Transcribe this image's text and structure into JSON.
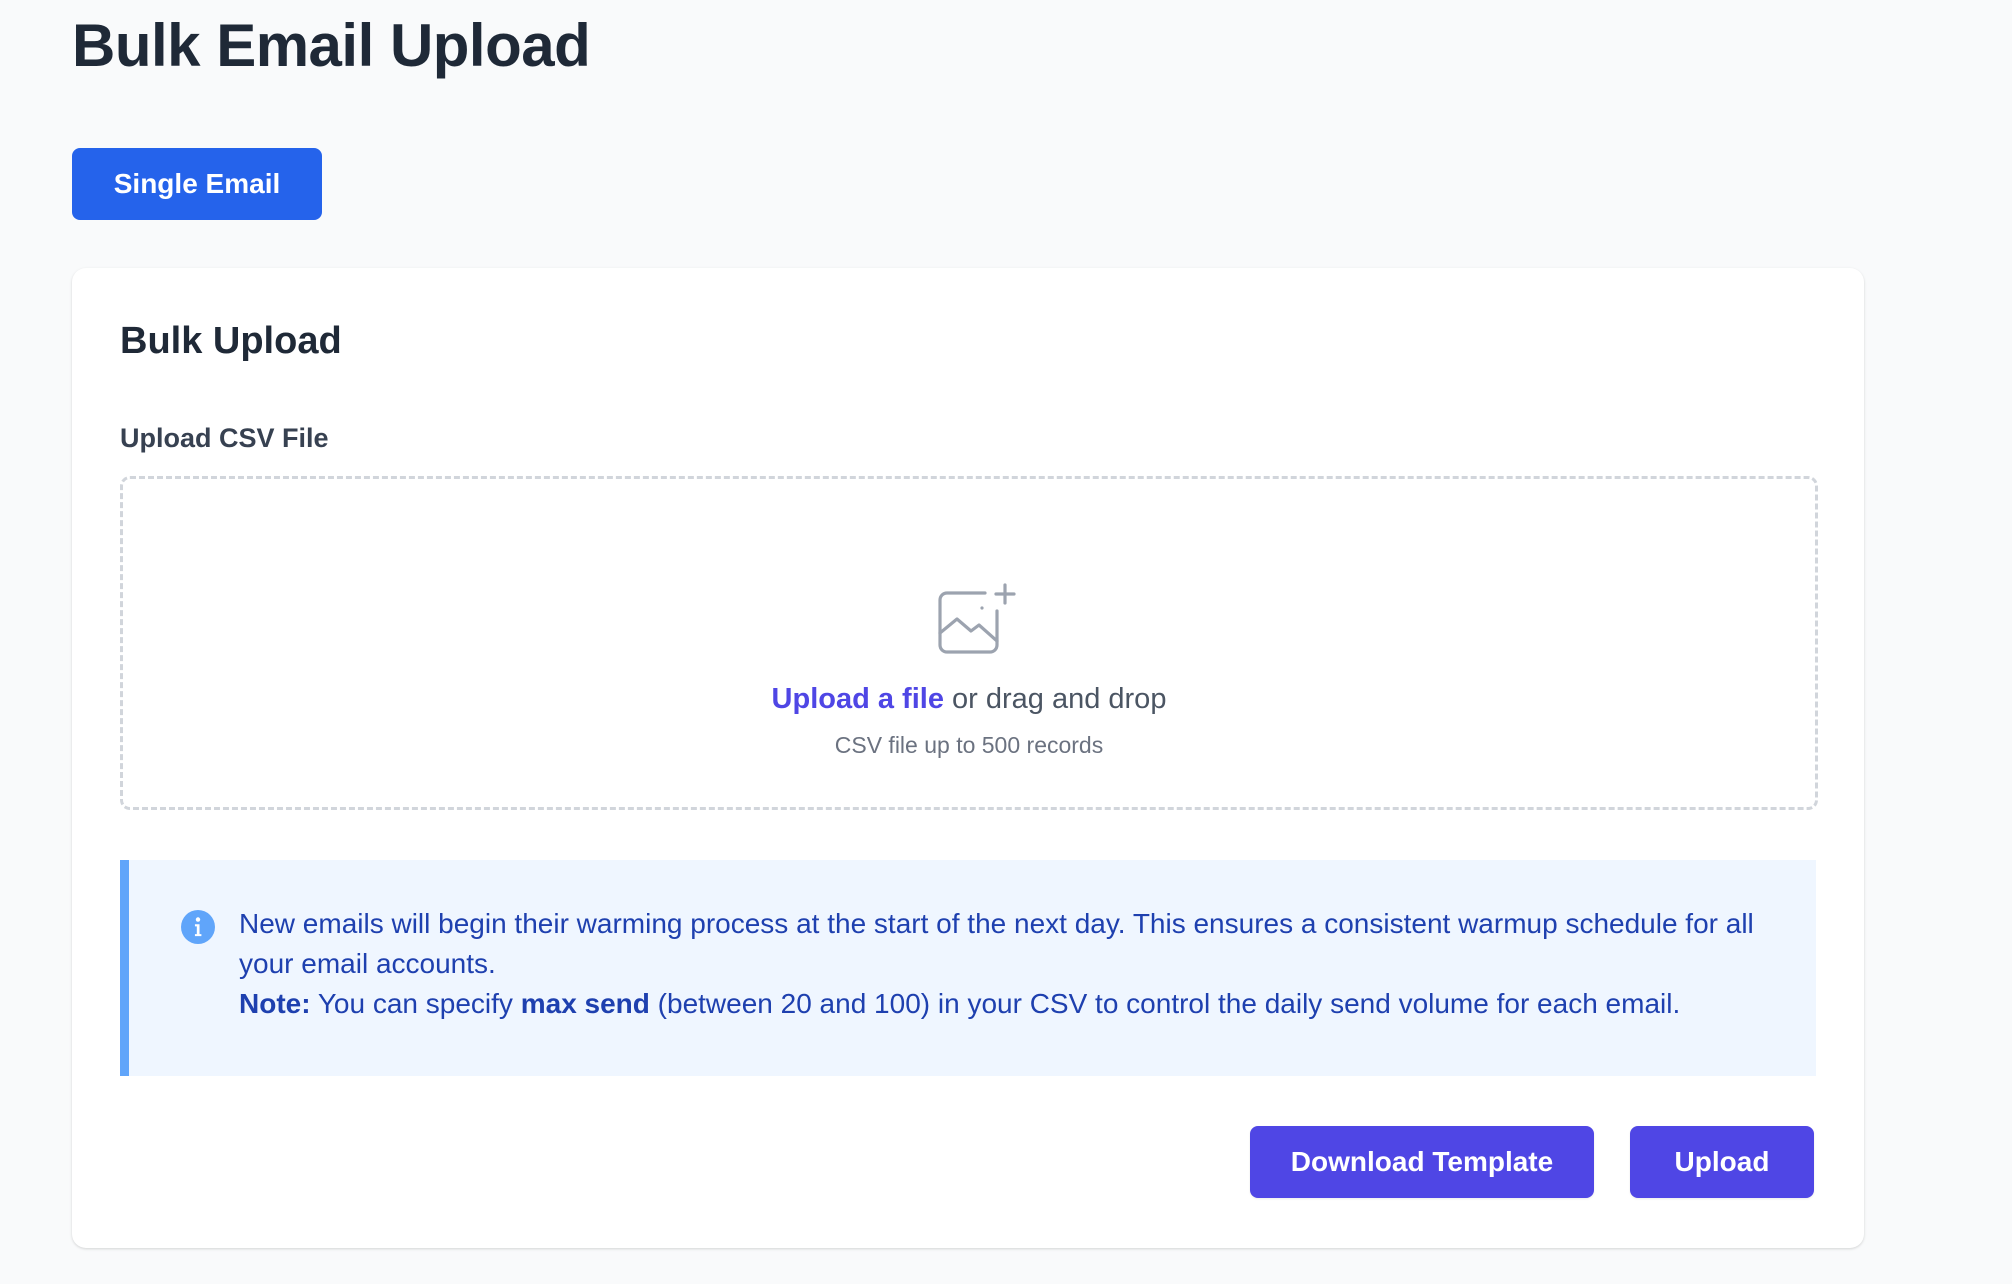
{
  "page": {
    "title": "Bulk Email Upload"
  },
  "mode_toggle": {
    "single_email_label": "Single Email"
  },
  "bulk_upload": {
    "title": "Bulk Upload",
    "field_label": "Upload CSV File",
    "dropzone": {
      "icon": "image-plus-icon",
      "upload_link": "Upload a file",
      "drag_text": "or drag and drop",
      "hint": "CSV file up to 500 records"
    },
    "info": {
      "icon": "info-circle-icon",
      "message": "New emails will begin their warming process at the start of the next day. This ensures a consistent warmup schedule for all your email accounts.",
      "note_label": "Note:",
      "note_text_before": "You can specify",
      "note_highlight": "max send",
      "note_text_after": "(between 20 and 100) in your CSV to control the daily send volume for each email."
    },
    "actions": {
      "download_template_label": "Download Template",
      "upload_label": "Upload"
    }
  },
  "colors": {
    "page_background": "#f9fafb",
    "primary_blue": "#2563eb",
    "indigo": "#4f46e5",
    "info_background": "#eff6ff",
    "info_border": "#60a5fa",
    "info_text": "#1e40af"
  }
}
